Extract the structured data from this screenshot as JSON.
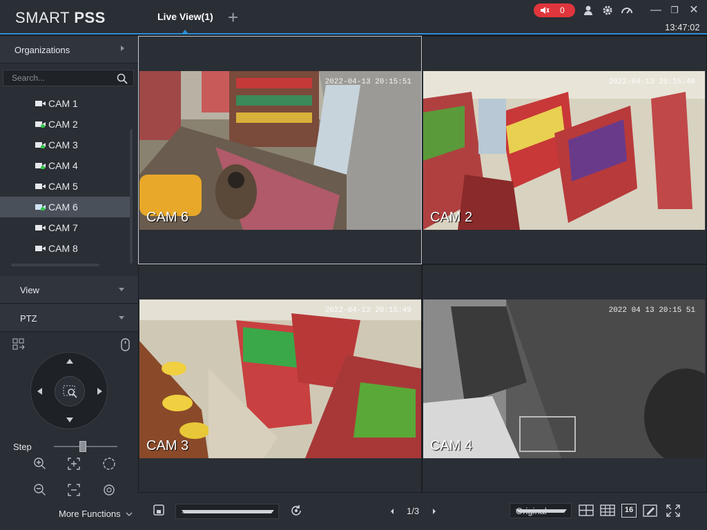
{
  "app": {
    "brand_light": "SMART ",
    "brand_bold": "PSS"
  },
  "tabs": [
    {
      "label": "Live View(1)"
    }
  ],
  "toolbar": {
    "alarm_count": "0",
    "time": "13:47:02"
  },
  "sidebar": {
    "organizations_label": "Organizations",
    "search_placeholder": "Search...",
    "cameras": [
      {
        "label": "CAM 1",
        "online": false
      },
      {
        "label": "CAM 2",
        "online": true
      },
      {
        "label": "CAM 3",
        "online": true
      },
      {
        "label": "CAM 4",
        "online": true
      },
      {
        "label": "CAM 5",
        "online": false
      },
      {
        "label": "CAM 6",
        "online": true,
        "selected": true
      },
      {
        "label": "CAM 7",
        "online": false
      },
      {
        "label": "CAM 8",
        "online": false
      }
    ],
    "view_label": "View",
    "ptz_label": "PTZ",
    "step_label": "Step",
    "step_value": 0.45,
    "more_functions_label": "More Functions"
  },
  "feeds": [
    {
      "name": "CAM 6",
      "timestamp": "2022-04-13 20:15:51",
      "active": true
    },
    {
      "name": "CAM 2",
      "timestamp": "2022-04-13 20:15:48"
    },
    {
      "name": "CAM 3",
      "timestamp": "2022-04-13 20:15:49"
    },
    {
      "name": "CAM 4",
      "timestamp": "2022 04 13 20:15 51"
    }
  ],
  "bottombar": {
    "preset_value": "--",
    "page": "1/3",
    "zoom_value": "Original",
    "layout16_label": "16"
  },
  "colors": {
    "accent": "#2d8fd5",
    "alarm": "#e0353c",
    "online": "#34c84a"
  }
}
